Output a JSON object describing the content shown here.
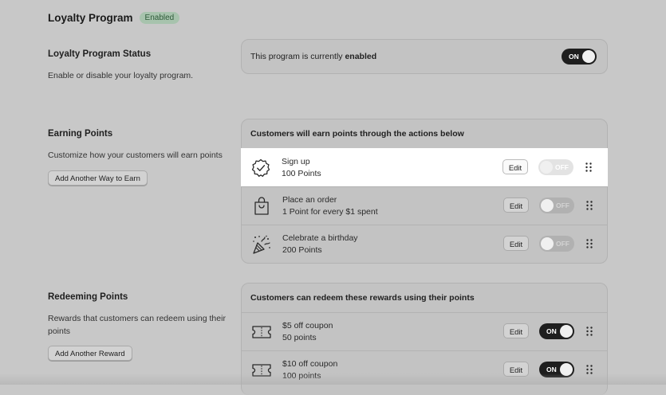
{
  "header": {
    "title": "Loyalty Program",
    "badge": "Enabled"
  },
  "status_section": {
    "title": "Loyalty Program Status",
    "description": "Enable or disable your loyalty program.",
    "text_prefix": "This program is currently",
    "text_state": "enabled",
    "toggle_label": "ON"
  },
  "earning": {
    "title": "Earning Points",
    "description": "Customize how your customers will earn points",
    "add_button": "Add Another Way to Earn",
    "card_title": "Customers will earn points through the actions below",
    "items": [
      {
        "name": "Sign up",
        "detail": "100 Points",
        "icon": "badge-check-icon",
        "edit": "Edit",
        "toggle": "OFF",
        "enabled": false
      },
      {
        "name": "Place an order",
        "detail": "1 Point for every $1 spent",
        "icon": "shopping-bag-icon",
        "edit": "Edit",
        "toggle": "OFF",
        "enabled": false
      },
      {
        "name": "Celebrate a birthday",
        "detail": "200 Points",
        "icon": "party-popper-icon",
        "edit": "Edit",
        "toggle": "OFF",
        "enabled": false
      }
    ]
  },
  "redeeming": {
    "title": "Redeeming Points",
    "description": "Rewards that customers can redeem using their points",
    "add_button": "Add Another Reward",
    "card_title": "Customers can redeem these rewards using their points",
    "items": [
      {
        "name": "$5 off coupon",
        "detail": "50 points",
        "icon": "ticket-icon",
        "edit": "Edit",
        "toggle": "ON",
        "enabled": true
      },
      {
        "name": "$10 off coupon",
        "detail": "100 points",
        "icon": "ticket-icon",
        "edit": "Edit",
        "toggle": "ON",
        "enabled": true
      }
    ]
  },
  "colors": {
    "background": "#c8c8c8",
    "badge_bg": "#a7c3ad",
    "badge_text": "#2f5b3a",
    "toggle_on": "#1e1e1e",
    "highlight_row": "#ffffff"
  }
}
